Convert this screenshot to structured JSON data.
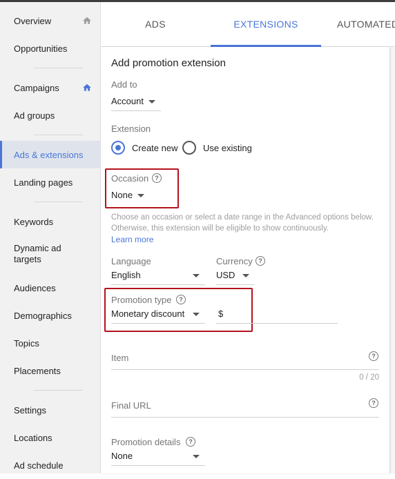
{
  "sidebar": {
    "items": [
      {
        "label": "Overview"
      },
      {
        "label": "Opportunities"
      },
      {
        "label": "Campaigns"
      },
      {
        "label": "Ad groups"
      },
      {
        "label": "Ads & extensions"
      },
      {
        "label": "Landing pages"
      },
      {
        "label": "Keywords"
      },
      {
        "label": "Dynamic ad targets"
      },
      {
        "label": "Audiences"
      },
      {
        "label": "Demographics"
      },
      {
        "label": "Topics"
      },
      {
        "label": "Placements"
      },
      {
        "label": "Settings"
      },
      {
        "label": "Locations"
      },
      {
        "label": "Ad schedule"
      }
    ],
    "active": "Ads & extensions"
  },
  "tabs": [
    {
      "label": "ADS"
    },
    {
      "label": "EXTENSIONS"
    },
    {
      "label": "AUTOMATED"
    }
  ],
  "form": {
    "title": "Add promotion extension",
    "add_to": {
      "label": "Add to",
      "value": "Account"
    },
    "extension": {
      "label": "Extension",
      "option_new": "Create new",
      "option_existing": "Use existing",
      "selected": "Create new"
    },
    "occasion": {
      "label": "Occasion",
      "value": "None"
    },
    "occasion_hint": "Choose an occasion or select a date range in the Advanced options below. Otherwise, this extension will be eligible to show continuously.",
    "learn_more": "Learn more",
    "language": {
      "label": "Language",
      "value": "English"
    },
    "currency": {
      "label": "Currency",
      "value": "USD"
    },
    "promotion_type": {
      "label": "Promotion type",
      "value": "Monetary discount"
    },
    "amount_prefix": "$",
    "item": {
      "label": "Item",
      "counter": "0 / 20"
    },
    "final_url": {
      "label": "Final URL"
    },
    "promotion_details": {
      "label": "Promotion details",
      "value": "None"
    }
  },
  "colors": {
    "accent": "#4a76d8",
    "highlight": "#b3121b"
  }
}
